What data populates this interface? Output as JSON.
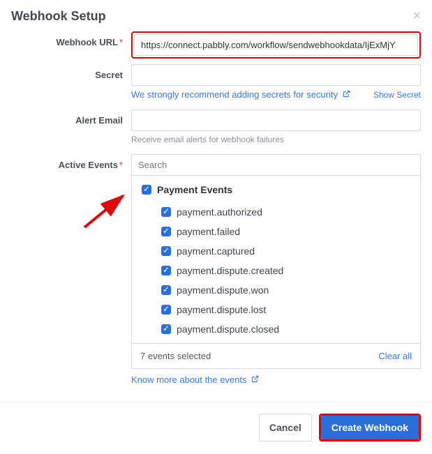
{
  "modal": {
    "title": "Webhook Setup"
  },
  "webhook_url": {
    "label": "Webhook URL",
    "value": "https://connect.pabbly.com/workflow/sendwebhookdata/IjExMjY"
  },
  "secret": {
    "label": "Secret",
    "value": "",
    "helper_link": "We strongly recommend adding secrets for security",
    "show_secret": "Show Secret"
  },
  "alert_email": {
    "label": "Alert Email",
    "value": "",
    "helper": "Receive email alerts for webhook failures"
  },
  "active_events": {
    "label": "Active Events",
    "search_placeholder": "Search",
    "group_label": "Payment Events",
    "events": [
      "payment.authorized",
      "payment.failed",
      "payment.captured",
      "payment.dispute.created",
      "payment.dispute.won",
      "payment.dispute.lost",
      "payment.dispute.closed"
    ],
    "selected_summary": "7 events selected",
    "clear_all": "Clear all",
    "know_more": "Know more about the events"
  },
  "footer": {
    "cancel": "Cancel",
    "create": "Create Webhook"
  }
}
